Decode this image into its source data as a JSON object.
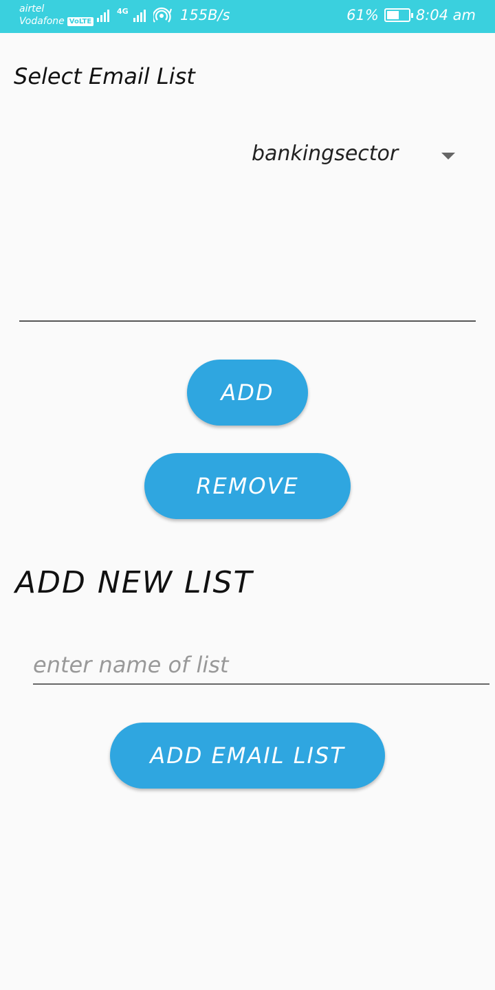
{
  "status_bar": {
    "carrier_1": "airtel",
    "carrier_2": "Vodafone",
    "volte_badge": "VoLTE",
    "network_type": "4G",
    "speed": "155B/s",
    "battery_percent": "61%",
    "battery_level": 0.61,
    "time": "8:04 am"
  },
  "select_section": {
    "label": "Select Email List",
    "selected_value": "bankingsector"
  },
  "buttons": {
    "add": "ADD",
    "remove": "REMOVE",
    "add_email_list": "ADD EMAIL LIST"
  },
  "new_list_section": {
    "heading": "ADD NEW LIST",
    "input_value": "",
    "input_placeholder": "enter name of list"
  },
  "colors": {
    "status_bar": "#3ad0de",
    "button": "#2fa6e0",
    "background": "#fafafa"
  }
}
